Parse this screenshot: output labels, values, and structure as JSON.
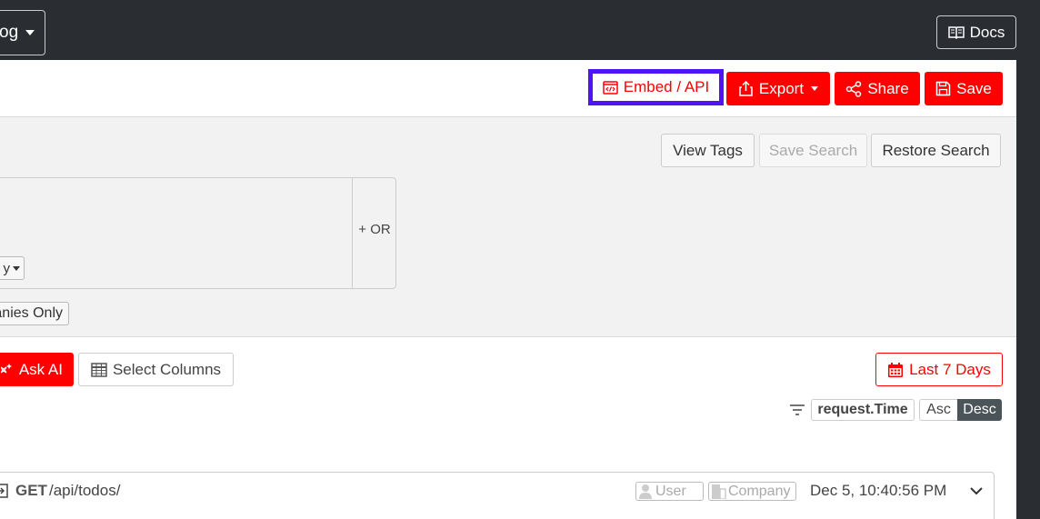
{
  "topbar": {
    "nav_label": "og",
    "docs_label": "Docs"
  },
  "header": {
    "embed_label": "Embed / API",
    "export_label": "Export",
    "share_label": "Share",
    "save_label": "Save"
  },
  "filters": {
    "view_tags": "View Tags",
    "save_search": "Save Search",
    "restore_search": "Restore Search",
    "or_label": "+ OR",
    "select_fragment": "y",
    "companies_only": "anies Only"
  },
  "toolbar": {
    "ask_ai": "Ask AI",
    "select_columns": "Select Columns",
    "date_range": "Last 7 Days",
    "sort_field": "request.Time",
    "sort_asc": "Asc",
    "sort_desc": "Desc"
  },
  "event": {
    "method": "GET",
    "path": "/api/todos/",
    "user_label": "User",
    "company_label": "Company",
    "timestamp": "Dec 5, 10:40:56 PM"
  },
  "colors": {
    "accent": "#ff0000",
    "topbar": "#2a2d32",
    "embed_highlight": "#4f14f5"
  }
}
